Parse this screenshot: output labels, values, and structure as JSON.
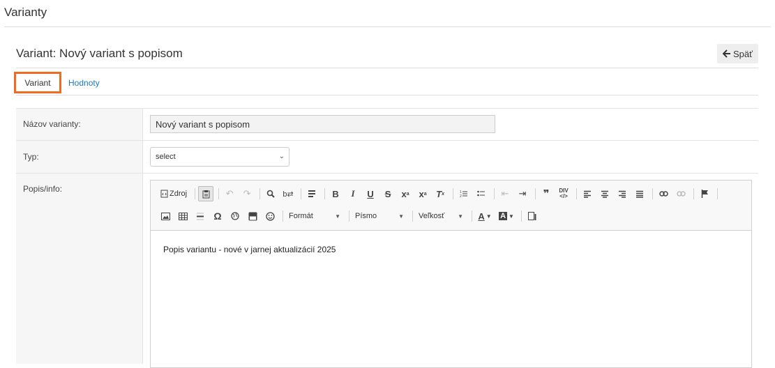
{
  "header": {
    "title": "Varianty"
  },
  "card": {
    "title": "Variant: Nový variant s popisom",
    "back_label": "Späť"
  },
  "tabs": [
    {
      "label": "Variant",
      "active": true
    },
    {
      "label": "Hodnoty",
      "active": false
    }
  ],
  "form": {
    "name_label": "Názov varianty:",
    "name_value": "Nový variant s popisom",
    "type_label": "Typ:",
    "type_value": "select",
    "desc_label": "Popis/info:"
  },
  "editor": {
    "source_label": "Zdroj",
    "format_label": "Formát",
    "font_label": "Písmo",
    "size_label": "Veľkosť",
    "content": "Popis variantu - nové v jarnej aktualizácií 2025"
  },
  "colors": {
    "accent": "#f06a24",
    "link": "#1a7bbf"
  }
}
